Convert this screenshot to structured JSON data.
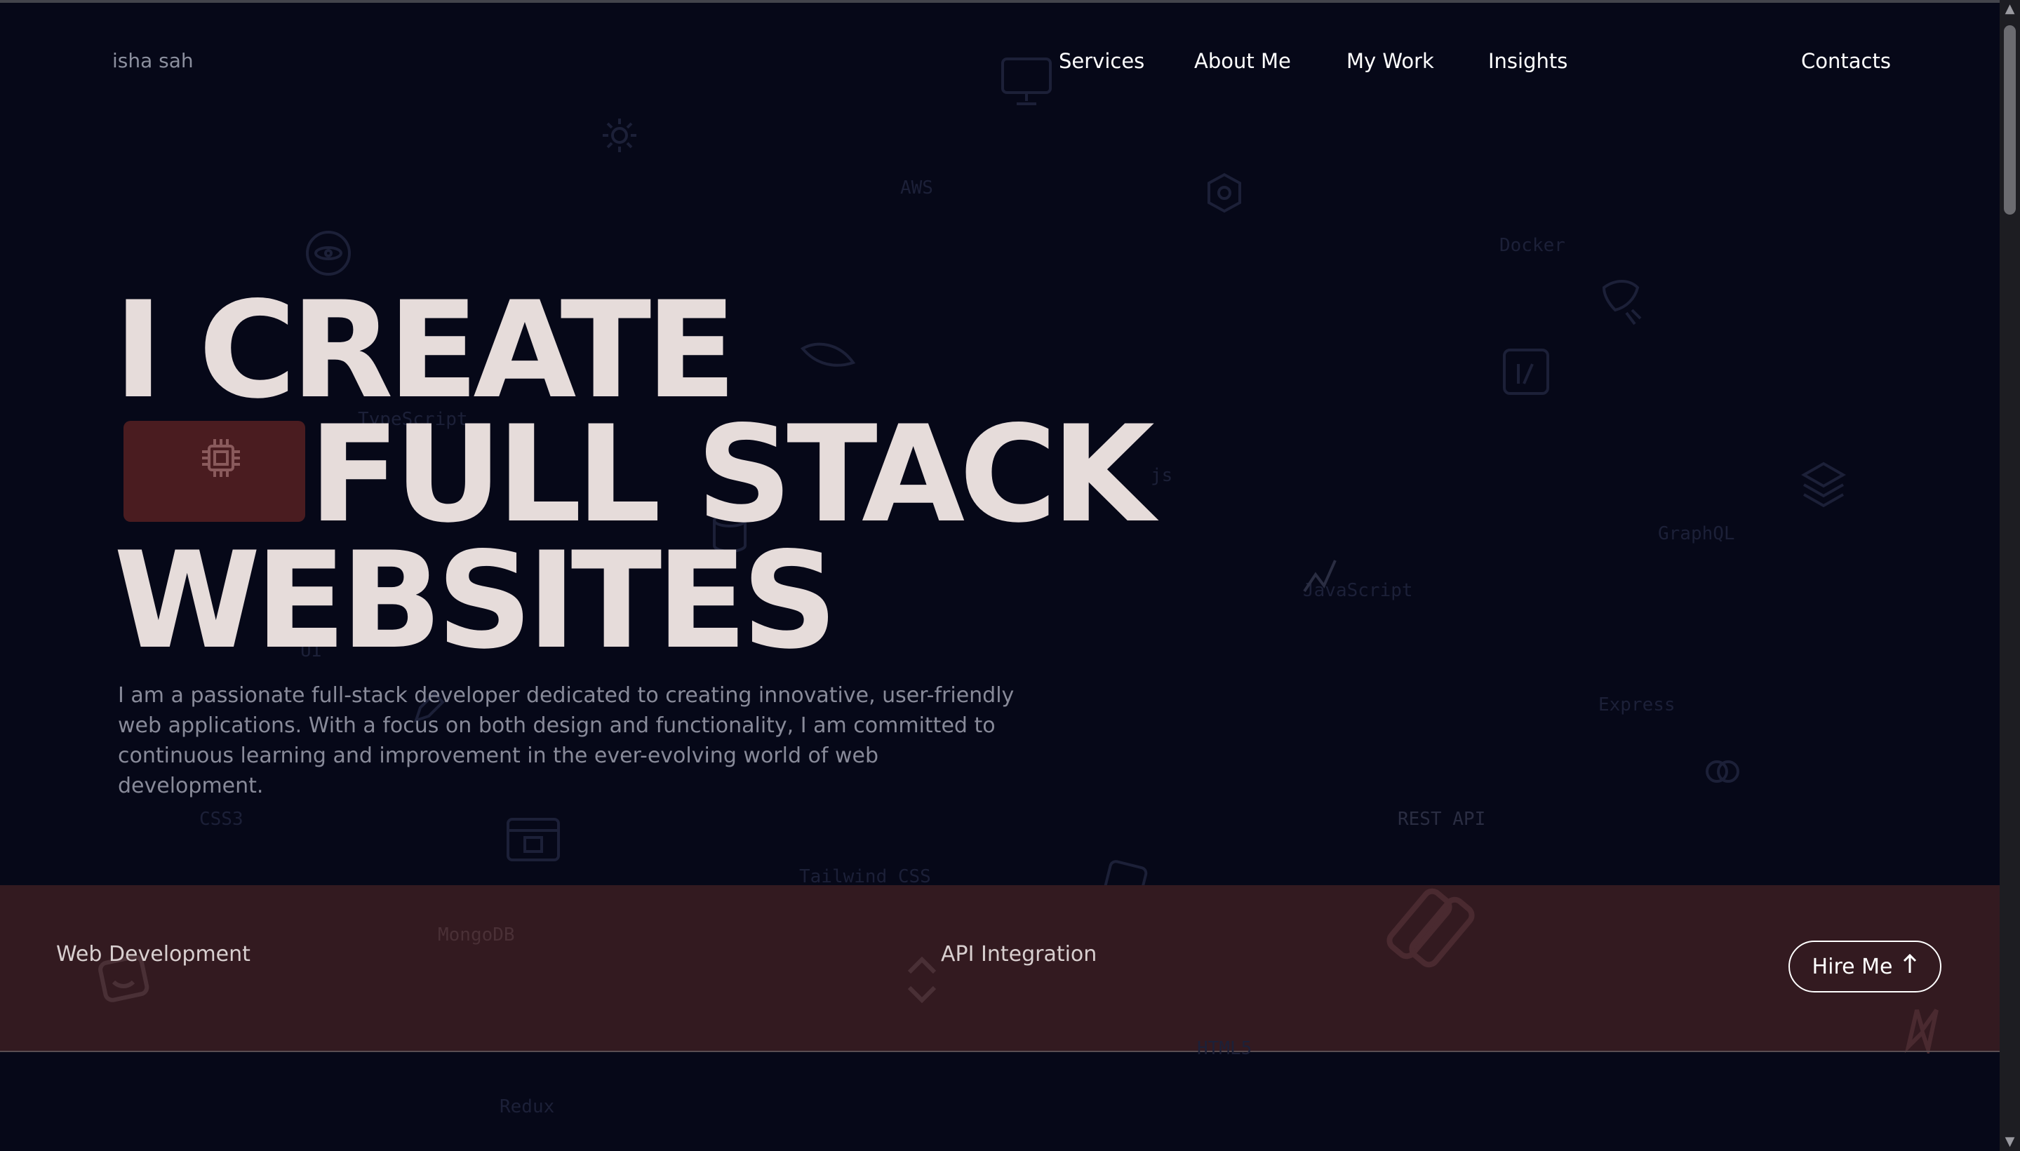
{
  "header": {
    "logo": "isha sah",
    "nav": [
      {
        "label": "Services"
      },
      {
        "label": "About Me"
      },
      {
        "label": "My Work"
      },
      {
        "label": "Insights"
      }
    ],
    "contacts": "Contacts"
  },
  "hero": {
    "line1": "I CREATE",
    "line2": "FULL STACK",
    "line3": "WEBSITES",
    "description": "I am a passionate full-stack developer dedicated to creating innovative, user-friendly web applications. With a focus on both design and functionality, I am committed to continuous learning and improvement in the ever-evolving world of web development."
  },
  "background_labels": {
    "aws": "AWS",
    "docker": "Docker",
    "typescript": "TypeScript",
    "js": "js",
    "graphql": "GraphQL",
    "javascript": "JavaScript",
    "ui": "UI",
    "express": "Express",
    "css3": "CSS3",
    "rest_api": "REST API",
    "tailwind": "Tailwind CSS",
    "mongodb": "MongoDB",
    "html5": "HTML5",
    "redux": "Redux"
  },
  "band": {
    "item1": "Web Development",
    "item2": "API Integration",
    "hire_label": "Hire Me"
  },
  "colors": {
    "background": "#060818",
    "band": "#331a20",
    "chip": "#4a1c20",
    "hero_text": "#e6dcda"
  }
}
